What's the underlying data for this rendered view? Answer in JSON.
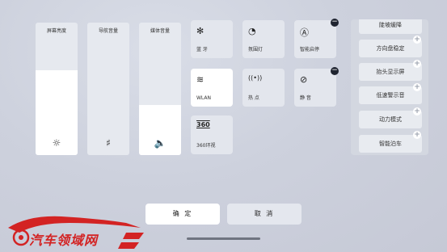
{
  "sliders": [
    {
      "title": "屏幕亮度",
      "icon": "☼",
      "icon_name": "brightness-icon",
      "level": 0.64
    },
    {
      "title": "导航音量",
      "icon": "♯",
      "icon_name": "muted-speaker-icon",
      "level": 0.0
    },
    {
      "title": "媒体音量",
      "icon": "🔈",
      "icon_name": "speaker-icon",
      "level": 0.38
    }
  ],
  "tiles": {
    "bluetooth": {
      "icon": "✻",
      "label": "蓝 牙"
    },
    "ambient": {
      "icon": "◔",
      "label": "氛围灯"
    },
    "autostartstop": {
      "icon": "Ⓐ",
      "label": "智能启停"
    },
    "wlan": {
      "icon": "≋",
      "label": "WLAN"
    },
    "hotspot": {
      "icon": "((•))",
      "label": "热 点"
    },
    "silent": {
      "icon": "⊘",
      "label": "静 音"
    },
    "surround360": {
      "icon": "360",
      "label": "360环视"
    }
  },
  "badges": {
    "remove": "−",
    "add": "+"
  },
  "side_panel": [
    "陡坡缓降",
    "方向盘稳定",
    "抬头显示屏",
    "低速警示音",
    "动力模式",
    "智能泊车"
  ],
  "buttons": {
    "confirm": "确 定",
    "cancel": "取 消"
  },
  "watermark": "汽车领域网",
  "colors": {
    "accent": "#ffffff",
    "watermark": "#d32323",
    "badge": "#1f2430"
  }
}
